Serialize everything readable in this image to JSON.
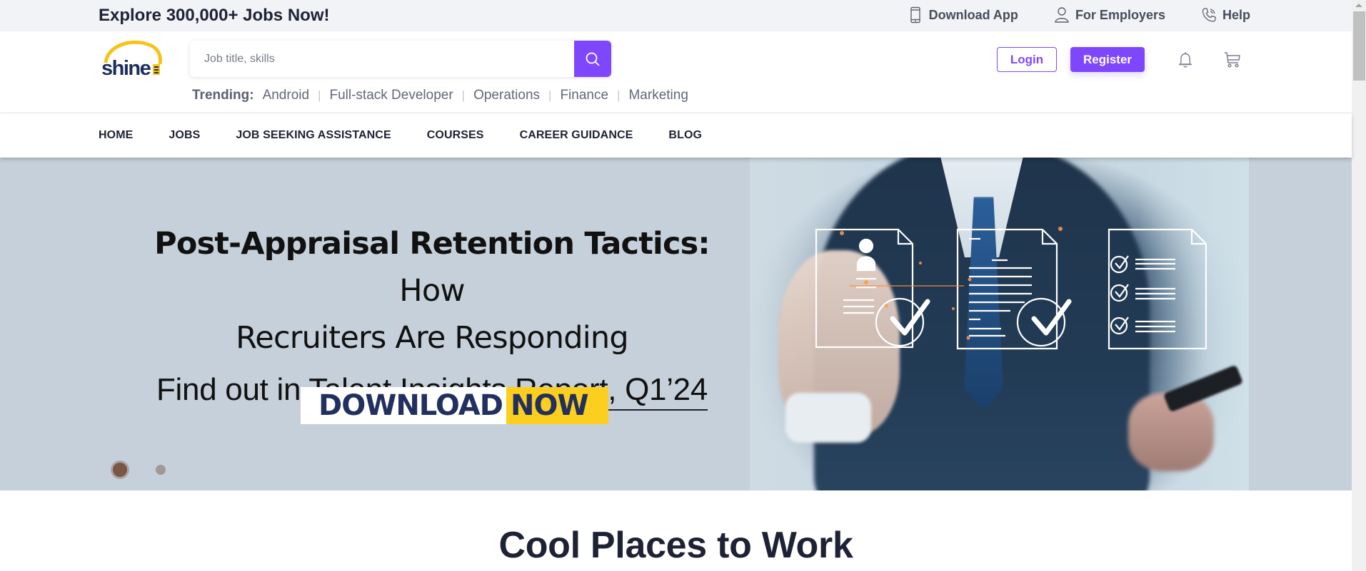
{
  "topbar": {
    "tagline": "Explore 300,000+ Jobs Now!",
    "links": [
      {
        "label": "Download App",
        "icon": "mobile-phone-icon"
      },
      {
        "label": "For Employers",
        "icon": "user-icon"
      },
      {
        "label": "Help",
        "icon": "phone-call-icon"
      }
    ]
  },
  "header": {
    "logo_text": "shine",
    "search": {
      "placeholder": "Job title, skills",
      "value": "",
      "button_icon": "search-icon"
    },
    "trending": {
      "label": "Trending:",
      "items": [
        "Android",
        "Full-stack Developer",
        "Operations",
        "Finance",
        "Marketing"
      ]
    },
    "login_label": "Login",
    "register_label": "Register",
    "icons": [
      "bell-icon",
      "cart-icon"
    ]
  },
  "nav": {
    "items": [
      "HOME",
      "JOBS",
      "JOB SEEKING ASSISTANCE",
      "COURSES",
      "CAREER GUIDANCE",
      "BLOG"
    ]
  },
  "banner": {
    "headline_bold": "Post-Appraisal Retention Tactics:",
    "headline_regular": " How",
    "headline_line2": "Recruiters Are Responding",
    "subline_prefix": "Find out in ",
    "subline_link": "Talent Insights Report, Q1’24",
    "cta_part1": "DOWNLOAD",
    "cta_part2": "NOW",
    "slides_total": 2,
    "active_slide": 1,
    "colors": {
      "background": "#c5d0da",
      "cta_navy": "#21305f",
      "cta_yellow": "#fccf1e"
    }
  },
  "section": {
    "title": "Cool Places to Work"
  },
  "theme": {
    "accent": "#7f47fc",
    "text_dark": "#1e2235",
    "topbar_bg": "#f2f3f7"
  }
}
